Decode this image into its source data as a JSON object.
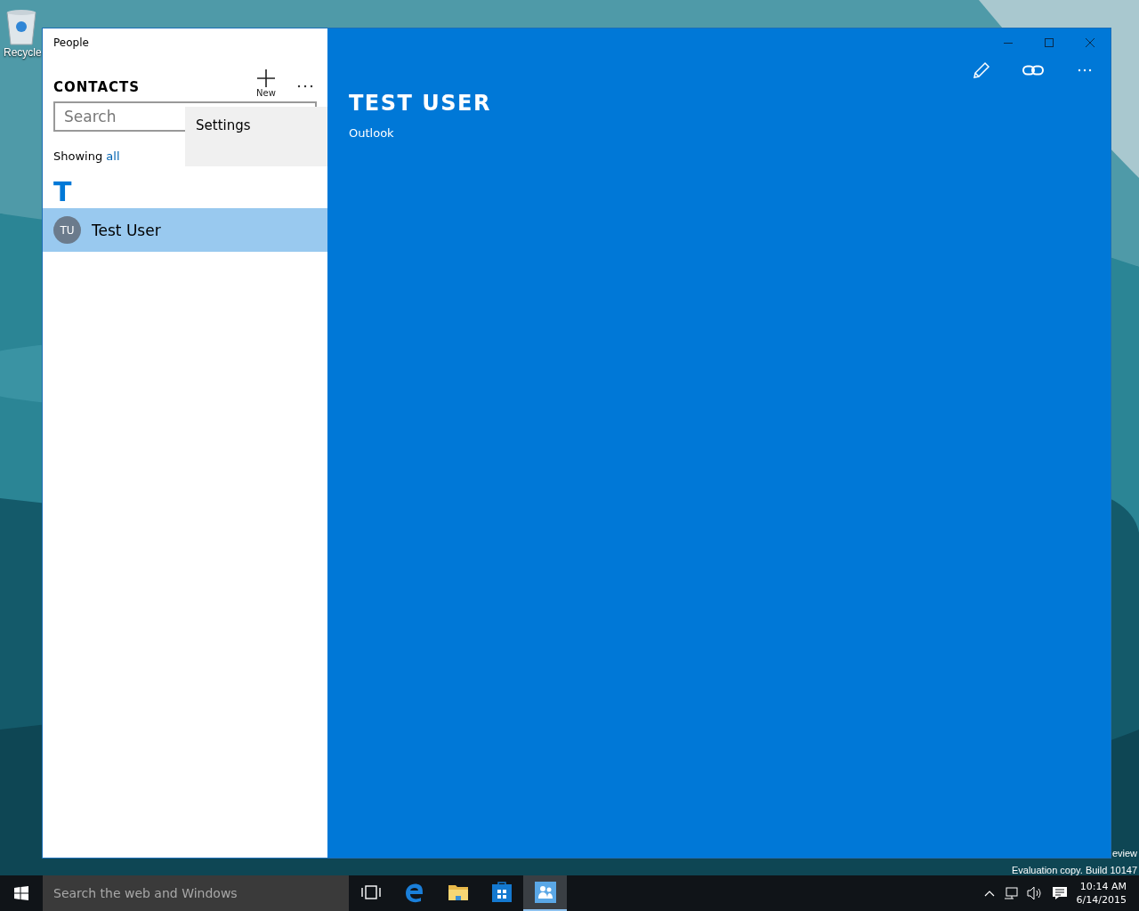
{
  "desktop": {
    "icons": [
      {
        "label": "Recycle"
      }
    ],
    "notes": [
      "eview",
      "Evaluation copy. Build 10147"
    ]
  },
  "window": {
    "title": "People",
    "sidebar": {
      "heading": "CONTACTS",
      "new_label": "New",
      "search": {
        "placeholder": "Search"
      },
      "filter": {
        "prefix": "Showing",
        "link": "all"
      },
      "groups": [
        {
          "letter": "T",
          "contacts": [
            {
              "initials": "TU",
              "name": "Test User",
              "selected": true
            }
          ]
        }
      ]
    },
    "menu": {
      "items": [
        "Settings"
      ]
    },
    "detail": {
      "name": "TEST USER",
      "source": "Outlook"
    }
  },
  "taskbar": {
    "search": {
      "placeholder": "Search the web and Windows"
    },
    "apps": [
      {
        "kind": "task-view",
        "selected": false
      },
      {
        "kind": "browser",
        "selected": false
      },
      {
        "kind": "folder",
        "selected": false
      },
      {
        "kind": "store",
        "selected": false
      },
      {
        "kind": "people",
        "selected": true
      }
    ],
    "clock": {
      "time": "10:14 AM",
      "date": "6/14/2015"
    }
  }
}
